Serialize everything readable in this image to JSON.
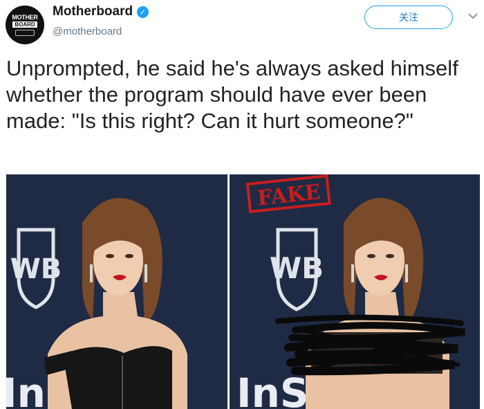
{
  "account": {
    "display_name": "Motherboard",
    "handle": "@motherboard",
    "avatar_text_top": "MOTHER",
    "avatar_text_bottom": "BOARD"
  },
  "follow_label": "关注",
  "tweet_text": "Unprompted, he said he's always asked himself whether the program should have ever been made: \"Is this right? Can it hurt someone?\"",
  "media": {
    "stamp_text": "FAKE",
    "wb_letters": "WB",
    "backdrop_text": "InS"
  },
  "colors": {
    "accent": "#1da1f2",
    "backdrop": "#1f2a44",
    "stamp": "#c81e1e"
  }
}
